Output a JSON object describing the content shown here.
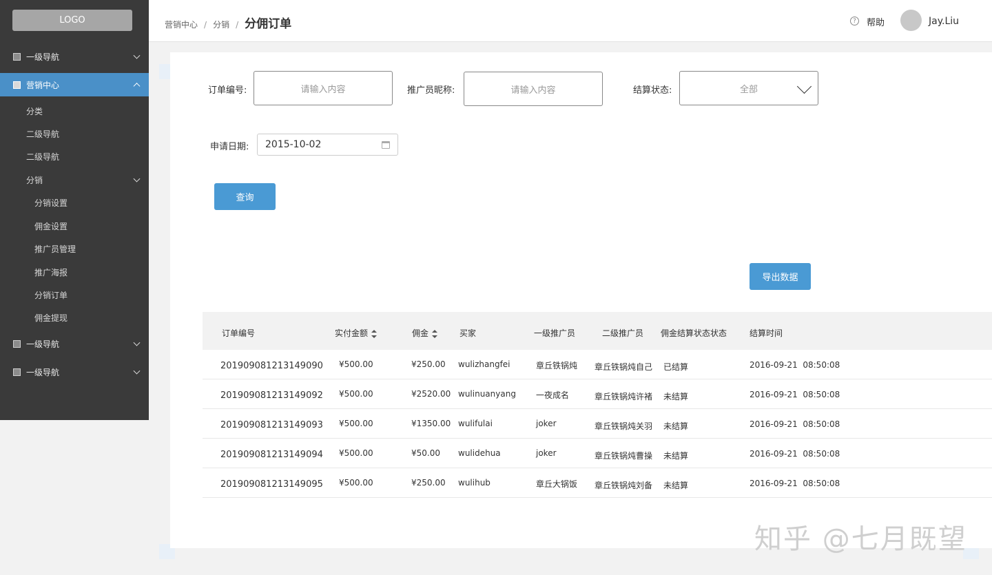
{
  "sidebar": {
    "logo": "LOGO",
    "items": [
      {
        "label": "一级导航"
      },
      {
        "label": "营销中心"
      },
      {
        "label": "分类"
      },
      {
        "label": "二级导航"
      },
      {
        "label": "二级导航"
      },
      {
        "label": "分销"
      },
      {
        "label": "分销设置"
      },
      {
        "label": "佣金设置"
      },
      {
        "label": "推广员管理"
      },
      {
        "label": "推广海报"
      },
      {
        "label": "分销订单"
      },
      {
        "label": "佣金提现"
      },
      {
        "label": "一级导航"
      },
      {
        "label": "一级导航"
      }
    ]
  },
  "header": {
    "breadcrumb": [
      "营销中心",
      "分销",
      "分佣订单"
    ],
    "help": "帮助",
    "username": "Jay.Liu"
  },
  "filters": {
    "order_no_label": "订单编号:",
    "order_no_placeholder": "请输入内容",
    "promoter_label": "推广员昵称:",
    "promoter_placeholder": "请输入内容",
    "status_label": "结算状态:",
    "status_value": "全部",
    "date_label": "申请日期:",
    "date_value": "2015-10-02",
    "query_button": "查询",
    "export_button": "导出数据"
  },
  "table": {
    "headers": [
      "订单编号",
      "实付金额",
      "佣金",
      "买家",
      "一级推广员",
      "二级推广员",
      "佣金结算状态状态",
      "结算时间"
    ],
    "rows": [
      [
        "201909081213149090",
        "¥500.00",
        "¥250.00",
        "wulizhangfei",
        "章丘铁锅炖",
        "章丘铁锅炖自己",
        "已结算",
        "2016-09-21  08:50:08"
      ],
      [
        "201909081213149092",
        "¥500.00",
        "¥2520.00",
        "wulinuanyang",
        "一夜成名",
        "章丘铁锅炖许褚",
        "未结算",
        "2016-09-21  08:50:08"
      ],
      [
        "201909081213149093",
        "¥500.00",
        "¥1350.00",
        "wulifulai",
        "joker",
        "章丘铁锅炖关羽",
        "未结算",
        "2016-09-21  08:50:08"
      ],
      [
        "201909081213149094",
        "¥500.00",
        "¥50.00",
        "wulidehua",
        "joker",
        "章丘铁锅炖曹操",
        "未结算",
        "2016-09-21  08:50:08"
      ],
      [
        "201909081213149095",
        "¥500.00",
        "¥250.00",
        "wulihub",
        "章丘大锅饭",
        "章丘铁锅炖刘备",
        "未结算",
        "2016-09-21  08:50:08"
      ]
    ]
  },
  "watermark": "知乎 @七月既望"
}
